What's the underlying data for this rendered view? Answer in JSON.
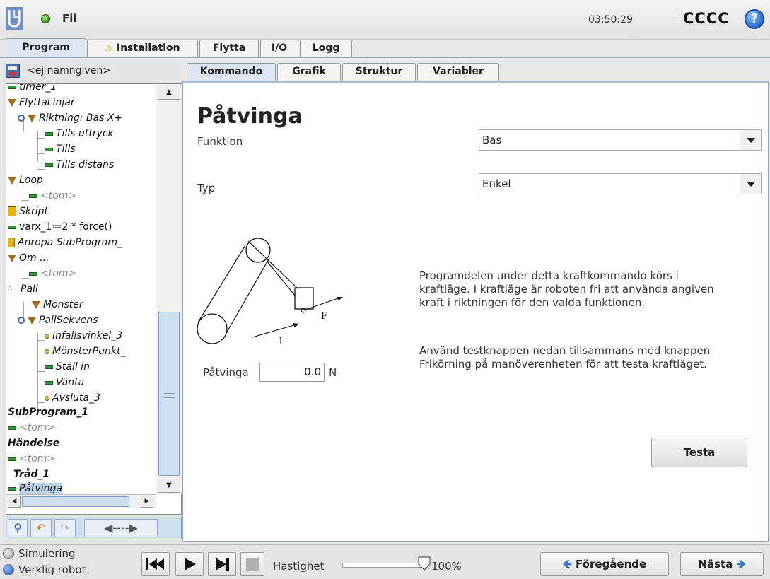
{
  "header": {
    "file_menu": "Fil",
    "clock": "03:50:29",
    "robot_name": "CCCC",
    "help": "?"
  },
  "main_tabs": [
    {
      "label": "Program",
      "active": true
    },
    {
      "label": "Installation",
      "warning": "⚠"
    },
    {
      "label": "Flytta"
    },
    {
      "label": "I/O"
    },
    {
      "label": "Logg"
    }
  ],
  "left": {
    "program_name": "<ej namngiven>",
    "tree": [
      {
        "label": "timer_1",
        "icon": "bar"
      },
      {
        "label": "FlyttaLinjär",
        "icon": "triangle"
      },
      {
        "label": "Riktning: Bas X+",
        "icon": "triangle"
      },
      {
        "label": "Tills uttryck",
        "icon": "bar"
      },
      {
        "label": "Tills",
        "icon": "bar"
      },
      {
        "label": "Tills distans",
        "icon": "bar"
      },
      {
        "label": "Loop",
        "icon": "triangle"
      },
      {
        "label": "<tom>",
        "icon": "bar"
      },
      {
        "label": "Skript",
        "icon": "script"
      },
      {
        "label": "varx_1≔2 * force()",
        "icon": "bar"
      },
      {
        "label": "Anropa SubProgram_",
        "icon": "call"
      },
      {
        "label": "Om ...",
        "icon": "triangle"
      },
      {
        "label": "<tom>",
        "icon": "bar"
      },
      {
        "label": "Pall",
        "icon": "pallet"
      },
      {
        "label": "Mönster",
        "icon": "triangle"
      },
      {
        "label": "PallSekvens",
        "icon": "triangle"
      },
      {
        "label": "Infallsvinkel_3",
        "icon": "dot"
      },
      {
        "label": "MönsterPunkt_",
        "icon": "dot"
      },
      {
        "label": "Ställ in",
        "icon": "bar"
      },
      {
        "label": "Vänta",
        "icon": "bar"
      },
      {
        "label": "Avsluta_3",
        "icon": "dot"
      },
      {
        "label": "SubProgram_1",
        "icon": "none"
      },
      {
        "label": "<tom>",
        "icon": "bar"
      },
      {
        "label": "Händelse",
        "icon": "none"
      },
      {
        "label": "<tom>",
        "icon": "bar"
      },
      {
        "label": "Tråd_1",
        "icon": "none"
      },
      {
        "label": "Påtvinga",
        "icon": "bar",
        "selected": true
      }
    ]
  },
  "sub_tabs": [
    {
      "label": "Kommando",
      "active": true
    },
    {
      "label": "Grafik"
    },
    {
      "label": "Struktur"
    },
    {
      "label": "Variabler"
    }
  ],
  "content": {
    "title": "Påtvinga",
    "funktion_label": "Funktion",
    "funktion_value": "Bas",
    "typ_label": "Typ",
    "typ_value": "Enkel",
    "diagram_labels": {
      "force": "F",
      "length": "l"
    },
    "force_label": "Påtvinga",
    "force_value": "0.0",
    "force_unit": "N",
    "description_1": "Programdelen under detta kraftkommando körs i kraftläge. I kraftläge är roboten fri att använda angiven kraft i riktningen för den valda funktionen.",
    "description_2": "Använd testknappen nedan tillsammans med knappen Frikörning på manöverenheten för att testa kraftläget.",
    "test_button": "Testa"
  },
  "footer": {
    "mode_simulation": "Simulering",
    "mode_real": "Verklig robot",
    "speed_label": "Hastighet",
    "speed_value": "100%",
    "speed_fraction": 1.0,
    "prev_button": "Föregående",
    "next_button": "Nästa"
  },
  "colors": {
    "accent": "#dde6f2",
    "status_ok": "#2e8c1a",
    "tree_command": "#2f9a2f",
    "tree_folder": "#a26a1a"
  }
}
